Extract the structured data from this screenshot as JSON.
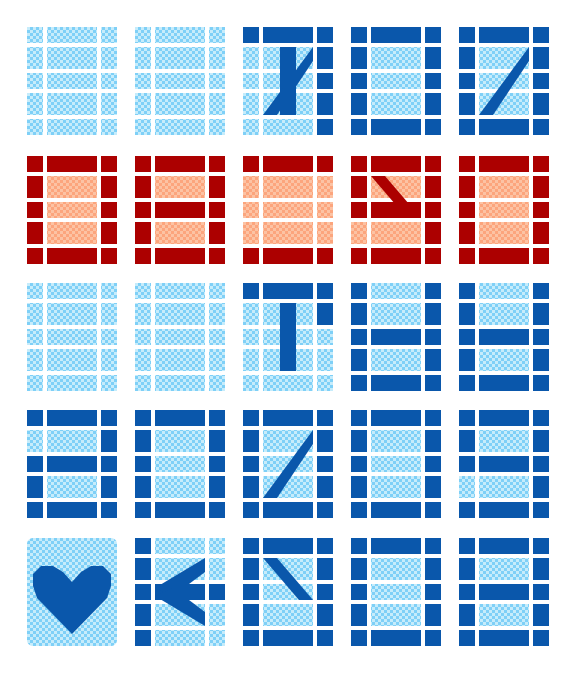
{
  "game": {
    "title": "",
    "palette": {
      "blue": {
        "on": "#0a57ab",
        "off": "#7fd0f7",
        "check": "#c6ecfb"
      },
      "red": {
        "on": "#ac0000",
        "off": "#fca57d",
        "check": "#fcc3a4"
      }
    },
    "rows": [
      {
        "color": "blue",
        "tiles": [
          {
            "label": "8",
            "glyph": "8",
            "lit": []
          },
          {
            "label": "8",
            "glyph": "8",
            "lit": []
          },
          {
            "label": "7",
            "glyph": "8",
            "lit": [
              "a",
              "b",
              "c",
              "m"
            ],
            "diag": "tr-bl"
          },
          {
            "label": "0",
            "glyph": "8",
            "lit": [
              "a",
              "b",
              "c",
              "d",
              "e",
              "f"
            ]
          },
          {
            "label": "Z",
            "glyph": "8",
            "lit": [
              "a",
              "b",
              "c",
              "d",
              "e",
              "f"
            ],
            "diag": "tr-bl"
          }
        ]
      },
      {
        "color": "red",
        "tiles": [
          {
            "label": "0",
            "glyph": "8",
            "lit": [
              "a",
              "b",
              "c",
              "d",
              "e",
              "f"
            ]
          },
          {
            "label": "8",
            "glyph": "8",
            "lit": [
              "a",
              "b",
              "c",
              "d",
              "e",
              "f",
              "g"
            ]
          },
          {
            "label": "E",
            "glyph": "8",
            "lit": [
              "a",
              "d"
            ]
          },
          {
            "label": "5",
            "glyph": "8",
            "lit": [
              "a",
              "b",
              "c",
              "d",
              "f",
              "g"
            ],
            "diag": "tl-br"
          },
          {
            "label": "0",
            "glyph": "8",
            "lit": [
              "a",
              "b",
              "c",
              "d",
              "e",
              "f"
            ]
          }
        ]
      },
      {
        "color": "blue",
        "tiles": [
          {
            "label": "8",
            "glyph": "8",
            "lit": []
          },
          {
            "label": "8",
            "glyph": "8",
            "lit": []
          },
          {
            "label": "1",
            "glyph": "8",
            "lit": [
              "a",
              "m",
              "b"
            ]
          },
          {
            "label": "8",
            "glyph": "8",
            "lit": [
              "b",
              "c",
              "e",
              "f",
              "g",
              "d"
            ]
          },
          {
            "label": "6",
            "glyph": "8",
            "lit": [
              "b",
              "c",
              "d",
              "e",
              "f",
              "g"
            ]
          }
        ]
      },
      {
        "color": "blue",
        "tiles": [
          {
            "label": "2",
            "glyph": "8",
            "lit": [
              "a",
              "b",
              "c",
              "e",
              "g",
              "d"
            ]
          },
          {
            "label": "0",
            "glyph": "8",
            "lit": [
              "a",
              "b",
              "c",
              "d",
              "e",
              "f"
            ]
          },
          {
            "label": "Z",
            "glyph": "8",
            "lit": [
              "a",
              "b",
              "c",
              "d",
              "e",
              "f"
            ],
            "diag": "tr-bl"
          },
          {
            "label": "0",
            "glyph": "8",
            "lit": [
              "a",
              "b",
              "c",
              "d",
              "e",
              "f"
            ]
          },
          {
            "label": "9",
            "glyph": "8",
            "lit": [
              "a",
              "b",
              "c",
              "d",
              "f",
              "g"
            ]
          }
        ]
      },
      {
        "color": "blue",
        "tiles": [
          {
            "label": "heart",
            "glyph": "heart",
            "lit": []
          },
          {
            "label": "K",
            "glyph": "8",
            "lit": [
              "e",
              "f",
              "g"
            ],
            "diag": "k"
          },
          {
            "label": "N",
            "glyph": "8",
            "lit": [
              "a",
              "b",
              "c",
              "d",
              "e",
              "f"
            ],
            "diag": "tl-br"
          },
          {
            "label": "0",
            "glyph": "8",
            "lit": [
              "a",
              "b",
              "c",
              "d",
              "e",
              "f"
            ]
          },
          {
            "label": "6",
            "glyph": "8",
            "lit": [
              "a",
              "b",
              "c",
              "d",
              "e",
              "f",
              "g"
            ]
          }
        ]
      }
    ]
  }
}
